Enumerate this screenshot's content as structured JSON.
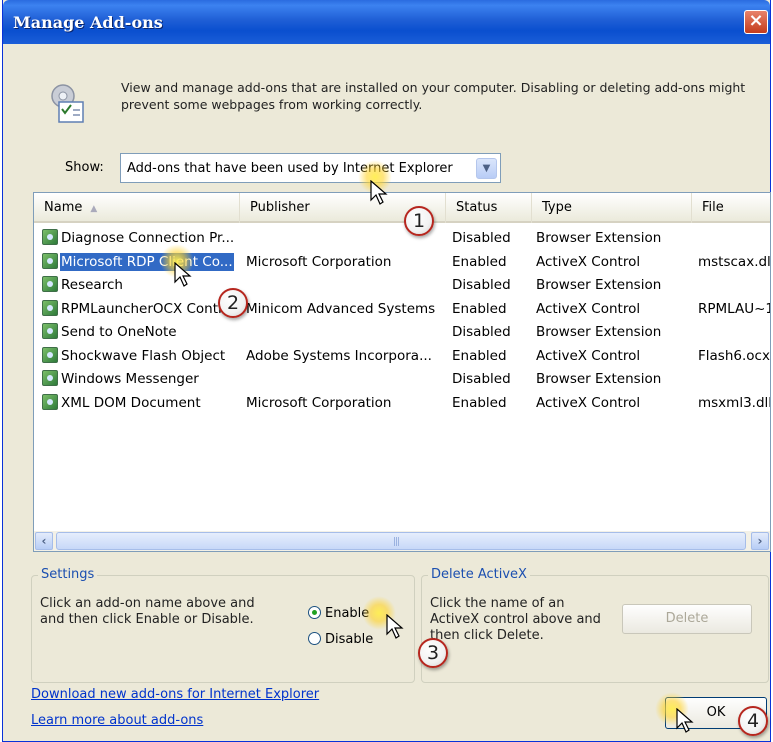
{
  "window": {
    "title": "Manage Add-ons",
    "close_glyph": "×"
  },
  "intro": {
    "icon": "addons-settings-icon",
    "text": "View and manage add-ons that are installed on your computer. Disabling or deleting add-ons might prevent some webpages from working correctly."
  },
  "show": {
    "label": "Show:",
    "value": "Add-ons that have been used by Internet Explorer"
  },
  "list": {
    "columns": {
      "name": "Name",
      "publisher": "Publisher",
      "status": "Status",
      "type": "Type",
      "file": "File"
    },
    "rows": [
      {
        "name": "Diagnose Connection Pr...",
        "publisher": "",
        "status": "Disabled",
        "type": "Browser Extension",
        "file": ""
      },
      {
        "name": "Microsoft RDP Client Co...",
        "publisher": "Microsoft Corporation",
        "status": "Enabled",
        "type": "ActiveX Control",
        "file": "mstscax.dl"
      },
      {
        "name": "Research",
        "publisher": "",
        "status": "Disabled",
        "type": "Browser Extension",
        "file": ""
      },
      {
        "name": "RPMLauncherOCX Contr",
        "publisher": "Minicom Advanced Systems",
        "status": "Enabled",
        "type": "ActiveX Control",
        "file": "RPMLAU~1"
      },
      {
        "name": "Send to OneNote",
        "publisher": "",
        "status": "Disabled",
        "type": "Browser Extension",
        "file": ""
      },
      {
        "name": "Shockwave Flash Object",
        "publisher": "Adobe Systems Incorpora...",
        "status": "Enabled",
        "type": "ActiveX Control",
        "file": "Flash6.ocx"
      },
      {
        "name": "Windows Messenger",
        "publisher": "",
        "status": "Disabled",
        "type": "Browser Extension",
        "file": ""
      },
      {
        "name": "XML DOM Document",
        "publisher": "Microsoft Corporation",
        "status": "Enabled",
        "type": "ActiveX Control",
        "file": "msxml3.dll"
      }
    ],
    "selected_index": 1
  },
  "settings": {
    "legend": "Settings",
    "description": "Click an add-on name above and and then click Enable or Disable.",
    "enable_label": "Enable",
    "disable_label": "Disable",
    "selected": "Enable"
  },
  "delete_activex": {
    "legend": "Delete ActiveX",
    "description": "Click the name of an ActiveX control above and then click Delete.",
    "button_label": "Delete"
  },
  "links": {
    "download": "Download new add-ons for Internet Explorer",
    "learn": "Learn more about add-ons"
  },
  "ok_label": "OK",
  "callouts": [
    "1",
    "2",
    "3",
    "4"
  ]
}
